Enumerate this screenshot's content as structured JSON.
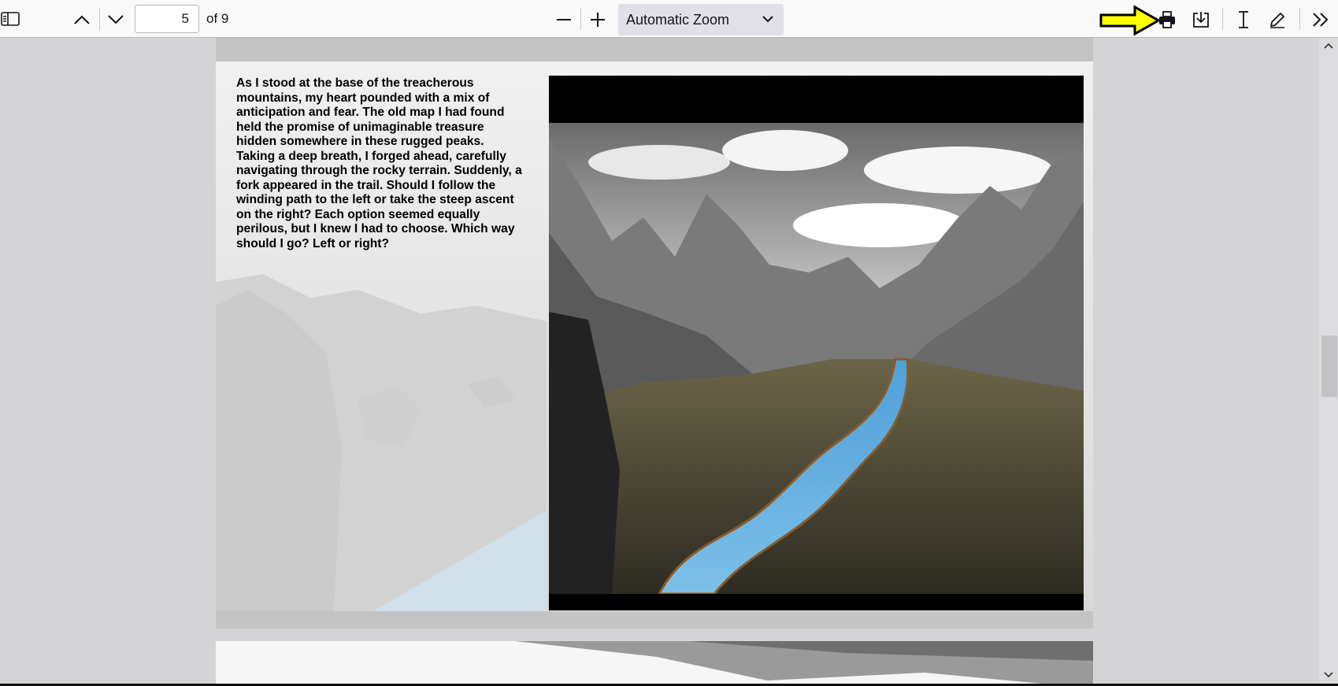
{
  "toolbar": {
    "sidebar_toggle_icon": "sidebar-toggle-icon",
    "page_number_value": "5",
    "page_count_label": "of 9",
    "zoom_selected": "Automatic Zoom",
    "icons": [
      "chevron-up-icon",
      "chevron-down-icon",
      "zoom-out-icon",
      "zoom-in-icon",
      "chevron-down-icon",
      "arrow-right-icon",
      "print-icon",
      "save-icon",
      "text-cursor-icon",
      "draw-pen-icon",
      "double-chevron-right-icon"
    ],
    "arrow_highlight_color": "#ffff00"
  },
  "document": {
    "story_text": "As I stood at the base of the treacherous mountains, my heart pounded with a mix of anticipation and fear. The old map I had found held the promise of unimaginable treasure hidden somewhere in these rugged peaks. Taking a deep breath, I forged ahead, carefully navigating through the rocky terrain. Suddenly, a fork appeared in the trail. Should I follow the winding path to the left or take the steep ascent on the right? Each option seemed equally perilous, but I knew I had to choose. Which way should I go? Left or right?",
    "illustration_description_icon": "mountain-river-illustration",
    "river_color": "#5aa8dc"
  }
}
